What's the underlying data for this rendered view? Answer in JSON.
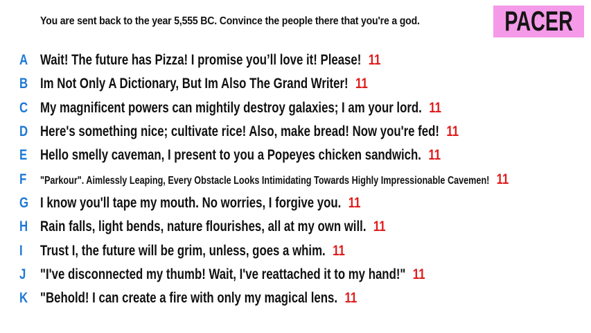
{
  "prompt": "You are sent back to the year 5,555 BC. Convince the people there that you're a god.",
  "badge": {
    "label": "PACER",
    "color": "#f49ae8"
  },
  "colors": {
    "letter": "#1e78d6",
    "count": "#e01b1b",
    "text": "#111111"
  },
  "answers": [
    {
      "letter": "A",
      "text": "Wait! The future has Pizza! I promise you’ll love it! Please!",
      "count": "11"
    },
    {
      "letter": "B",
      "text": "Im Not Only A Dictionary, But Im Also The Grand Writer!",
      "count": "11"
    },
    {
      "letter": "C",
      "text": "My magnificent powers can mightily destroy galaxies; I am your lord.",
      "count": "11"
    },
    {
      "letter": "D",
      "text": "Here's something nice; cultivate rice! Also, make bread! Now you're fed!",
      "count": "11"
    },
    {
      "letter": "E",
      "text": "Hello smelly caveman, I present to you a Popeyes chicken sandwich.",
      "count": "11"
    },
    {
      "letter": "F",
      "text": "\"Parkour\". Aimlessly Leaping, Every Obstacle Looks Intimidating Towards Highly Impressionable Cavemen!",
      "count": "11"
    },
    {
      "letter": "G",
      "text": "I know you'll tape my mouth. No worries, I forgive you.",
      "count": "11"
    },
    {
      "letter": "H",
      "text": "Rain falls, light bends, nature flourishes, all at my own will.",
      "count": "11"
    },
    {
      "letter": "I",
      "text": "Trust I, the future will be grim, unless, goes a whim.",
      "count": "11"
    },
    {
      "letter": "J",
      "text": "\"I've disconnected my thumb! Wait, I've reattached it to my hand!\"",
      "count": "11"
    },
    {
      "letter": "K",
      "text": "\"Behold! I can create a fire with only my magical lens.",
      "count": "11"
    }
  ]
}
